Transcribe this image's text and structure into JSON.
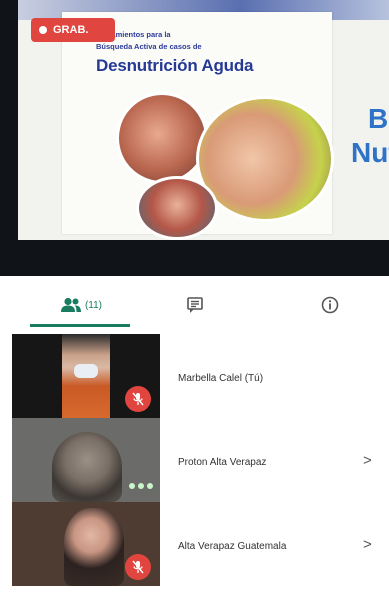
{
  "recording": {
    "label": "GRAB."
  },
  "slide": {
    "subtitle_line1": "Lineamientos para la",
    "subtitle_line2": "Búsqueda Activa de casos de",
    "title": "Desnutrición Aguda",
    "big_text_line1": "B",
    "big_text_line2": "Nut"
  },
  "tabs": {
    "people": {
      "icon": "people-icon",
      "count": "(11)"
    },
    "chat": {
      "icon": "chat-icon"
    },
    "info": {
      "icon": "info-icon"
    }
  },
  "participants": [
    {
      "name": "Marbella Calel (Tú)",
      "status_icon": "mic-off-icon",
      "has_chevron": false
    },
    {
      "name": "Proton Alta Verapaz",
      "status_icon": "speaking-dots-icon",
      "has_chevron": true,
      "chevron": ">"
    },
    {
      "name": "Alta Verapaz Guatemala",
      "status_icon": "mic-off-icon",
      "has_chevron": true,
      "chevron": ">"
    }
  ],
  "colors": {
    "accent": "#1a7c5e",
    "recording": "#e0463f",
    "slide_title": "#263a95"
  }
}
